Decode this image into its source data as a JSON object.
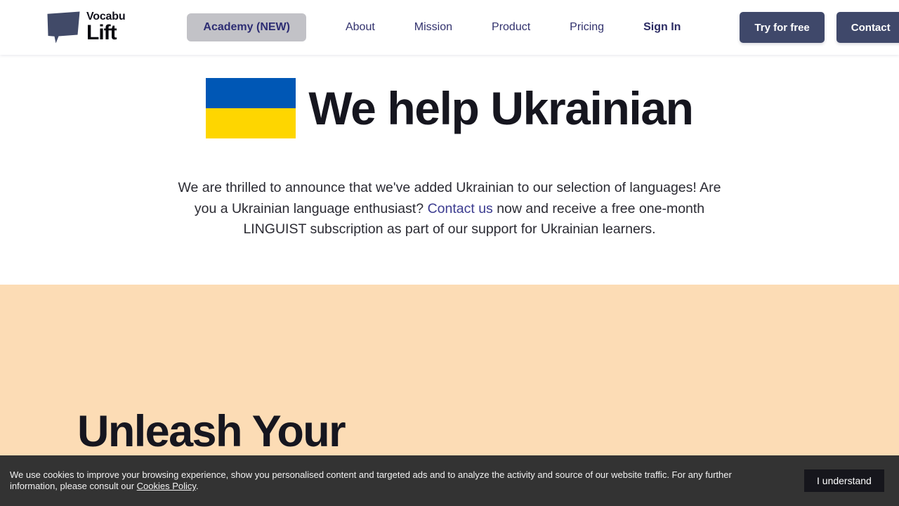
{
  "header": {
    "logo": {
      "icon": "speech-bubble-logo-icon",
      "top_word": "Vocabu",
      "bottom_word": "Lift"
    },
    "nav": [
      {
        "label": "Academy (NEW)",
        "state": "active"
      },
      {
        "label": "About",
        "state": "default"
      },
      {
        "label": "Mission",
        "state": "default"
      },
      {
        "label": "Product",
        "state": "default"
      },
      {
        "label": "Pricing",
        "state": "default"
      },
      {
        "label": "Sign In",
        "state": "bold"
      }
    ],
    "actions": {
      "try_label": "Try for free",
      "contact_label": "Contact"
    },
    "colors": {
      "nav_link": "#31316d",
      "active_bg": "#c2c2c7",
      "button_bg": "#3f486a"
    }
  },
  "hero": {
    "flag": {
      "name": "ukraine-flag",
      "top_color": "#0057b5",
      "bottom_color": "#fed600"
    },
    "title": "We help Ukrainian",
    "paragraph": {
      "before_link": "We are thrilled to announce that we've added Ukrainian to our selection of languages! Are you a Ukrainian language enthusiast? ",
      "link_text": "Contact us",
      "after_link": " now and receive a free one-month LINGUIST subscription as part of our support for Ukrainian learners."
    },
    "link_color": "#3b3b8f"
  },
  "orange_section": {
    "heading": "Unleash Your",
    "background": "#fcdcb5"
  },
  "cookie_banner": {
    "text_before_link": "We use cookies to improve your browsing experience, show you personalised content and targeted ads and to analyze the activity and source of our website traffic. For any further information, please consult our ",
    "link_text": "Cookies Policy",
    "text_after_link": ".",
    "accept_label": "I understand",
    "background": "#333333"
  }
}
